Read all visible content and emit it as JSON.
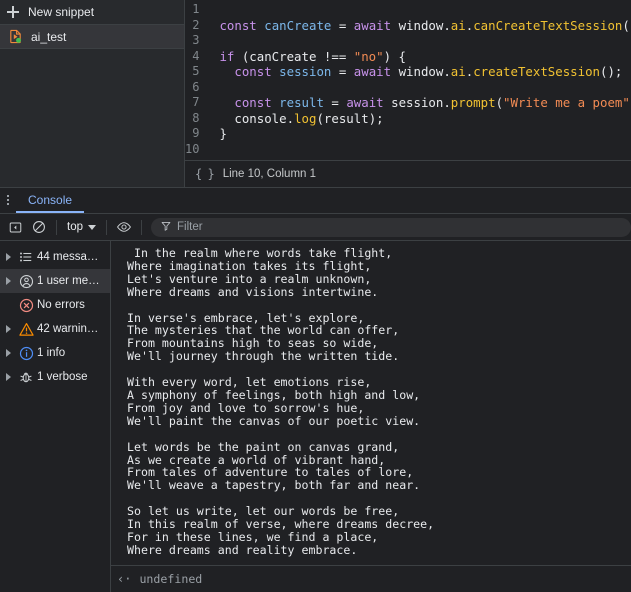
{
  "snippets_panel": {
    "new_snippet_label": "New snippet",
    "new_snippet_icon": "plus-icon",
    "items": [
      {
        "name": "ai_test",
        "icon": "snippet-file-run-icon"
      }
    ]
  },
  "editor": {
    "lines": [
      {
        "n": "1",
        "tokens": []
      },
      {
        "n": "2",
        "tokens": [
          {
            "t": "",
            "c": "plain"
          },
          {
            "t": "const",
            "c": "kw"
          },
          {
            "t": " ",
            "c": "plain"
          },
          {
            "t": "canCreate",
            "c": "var"
          },
          {
            "t": " ",
            "c": "plain"
          },
          {
            "t": "=",
            "c": "op"
          },
          {
            "t": " ",
            "c": "plain"
          },
          {
            "t": "await",
            "c": "kw"
          },
          {
            "t": " ",
            "c": "plain"
          },
          {
            "t": "window",
            "c": "prop"
          },
          {
            "t": ".",
            "c": "punc"
          },
          {
            "t": "ai",
            "c": "ai"
          },
          {
            "t": ".",
            "c": "punc"
          },
          {
            "t": "canCreateTextSession",
            "c": "ai"
          },
          {
            "t": "();",
            "c": "punc"
          }
        ]
      },
      {
        "n": "3",
        "tokens": []
      },
      {
        "n": "4",
        "tokens": [
          {
            "t": "if",
            "c": "kw"
          },
          {
            "t": " (",
            "c": "punc"
          },
          {
            "t": "canCreate",
            "c": "prop"
          },
          {
            "t": " ",
            "c": "plain"
          },
          {
            "t": "!==",
            "c": "op"
          },
          {
            "t": " ",
            "c": "plain"
          },
          {
            "t": "\"no\"",
            "c": "str"
          },
          {
            "t": ") {",
            "c": "punc"
          }
        ]
      },
      {
        "n": "5",
        "tokens": [
          {
            "t": "  ",
            "c": "plain"
          },
          {
            "t": "const",
            "c": "kw"
          },
          {
            "t": " ",
            "c": "plain"
          },
          {
            "t": "session",
            "c": "var"
          },
          {
            "t": " ",
            "c": "plain"
          },
          {
            "t": "=",
            "c": "op"
          },
          {
            "t": " ",
            "c": "plain"
          },
          {
            "t": "await",
            "c": "kw"
          },
          {
            "t": " ",
            "c": "plain"
          },
          {
            "t": "window",
            "c": "prop"
          },
          {
            "t": ".",
            "c": "punc"
          },
          {
            "t": "ai",
            "c": "ai"
          },
          {
            "t": ".",
            "c": "punc"
          },
          {
            "t": "createTextSession",
            "c": "ai"
          },
          {
            "t": "();",
            "c": "punc"
          }
        ]
      },
      {
        "n": "6",
        "tokens": []
      },
      {
        "n": "7",
        "tokens": [
          {
            "t": "  ",
            "c": "plain"
          },
          {
            "t": "const",
            "c": "kw"
          },
          {
            "t": " ",
            "c": "plain"
          },
          {
            "t": "result",
            "c": "var"
          },
          {
            "t": " ",
            "c": "plain"
          },
          {
            "t": "=",
            "c": "op"
          },
          {
            "t": " ",
            "c": "plain"
          },
          {
            "t": "await",
            "c": "kw"
          },
          {
            "t": " ",
            "c": "plain"
          },
          {
            "t": "session",
            "c": "prop"
          },
          {
            "t": ".",
            "c": "punc"
          },
          {
            "t": "prompt",
            "c": "fn"
          },
          {
            "t": "(",
            "c": "punc"
          },
          {
            "t": "\"Write me a poem\"",
            "c": "str"
          },
          {
            "t": ");",
            "c": "punc"
          }
        ]
      },
      {
        "n": "8",
        "tokens": [
          {
            "t": "  ",
            "c": "plain"
          },
          {
            "t": "console",
            "c": "prop"
          },
          {
            "t": ".",
            "c": "punc"
          },
          {
            "t": "log",
            "c": "fn"
          },
          {
            "t": "(",
            "c": "punc"
          },
          {
            "t": "result",
            "c": "prop"
          },
          {
            "t": ");",
            "c": "punc"
          }
        ]
      },
      {
        "n": "9",
        "tokens": [
          {
            "t": "}",
            "c": "punc"
          }
        ]
      },
      {
        "n": "10",
        "tokens": []
      }
    ],
    "status": {
      "icon": "curly-braces-icon",
      "icon_glyph": "{ }",
      "text": "Line 10, Column 1"
    }
  },
  "drawer": {
    "drag_handle_icon": "drag-dots-icon",
    "tabs": [
      {
        "label": "Console",
        "selected": true
      }
    ],
    "toolbar": {
      "sidebar_toggle_icon": "console-sidebar-toggle-icon",
      "clear_console_icon": "clear-console-icon",
      "context_selector": {
        "value": "top",
        "caret_icon": "chevron-down-icon"
      },
      "live_expression_icon": "eye-icon",
      "filter": {
        "icon": "filter-funnel-icon",
        "placeholder": "Filter",
        "value": ""
      }
    }
  },
  "console_sidebar": {
    "items": [
      {
        "label": "44 messa…",
        "icon": "list-messages-icon",
        "expandable": true,
        "selected": false,
        "color": "#cdd1d4"
      },
      {
        "label": "1 user me…",
        "icon": "user-message-icon",
        "expandable": true,
        "selected": true,
        "color": "#cdd1d4"
      },
      {
        "label": "No errors",
        "icon": "error-circle-x-icon",
        "expandable": false,
        "selected": false,
        "color": "#f28b82"
      },
      {
        "label": "42 warnin…",
        "icon": "warning-triangle-icon",
        "expandable": true,
        "selected": false,
        "color": "#fb8c00"
      },
      {
        "label": "1 info",
        "icon": "info-circle-icon",
        "expandable": true,
        "selected": false,
        "color": "#4e8ef7"
      },
      {
        "label": "1 verbose",
        "icon": "bug-verbose-icon",
        "expandable": true,
        "selected": false,
        "color": "#cdd1d4"
      }
    ]
  },
  "console_output": {
    "message": " In the realm where words take flight,\nWhere imagination takes its flight,\nLet's venture into a realm unknown,\nWhere dreams and visions intertwine.\n\nIn verse's embrace, let's explore,\nThe mysteries that the world can offer,\nFrom mountains high to seas so wide,\nWe'll journey through the written tide.\n\nWith every word, let emotions rise,\nA symphony of feelings, both high and low,\nFrom joy and love to sorrow's hue,\nWe'll paint the canvas of our poetic view.\n\nLet words be the paint on canvas grand,\nAs we create a world of vibrant hand,\nFrom tales of adventure to tales of lore,\nWe'll weave a tapestry, both far and near.\n\nSo let us write, let our words be free,\nIn this realm of verse, where dreams decree,\nFor in these lines, we find a place,\nWhere dreams and reality embrace.",
    "result": {
      "arrow_icon": "return-value-arrow-icon",
      "arrow_glyph": "‹·",
      "value": "undefined"
    }
  },
  "colors": {
    "background": "#202124",
    "panel": "#282a2d",
    "selection": "#35363a",
    "border": "#3c4043",
    "accent": "#8ab4f8",
    "text": "#e8eaed",
    "muted": "#9aa0a6",
    "kw": "#c792ea",
    "var": "#7cb7ea",
    "fn": "#f1c232",
    "str": "#f28b54",
    "error": "#f28b82",
    "warn": "#fb8c00",
    "info": "#4e8ef7"
  }
}
